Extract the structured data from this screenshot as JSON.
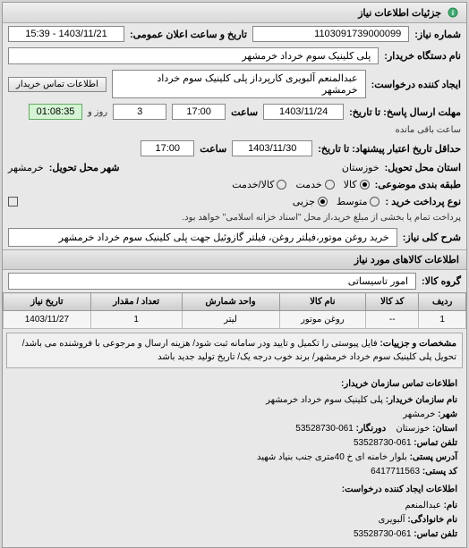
{
  "panel_title": "جزئیات اطلاعات نیاز",
  "header": {
    "req_number_label": "شماره نیاز:",
    "req_number": "1103091739000099",
    "announce_label": "تاریخ و ساعت اعلان عمومی:",
    "announce_value": "1403/11/21 - 15:39"
  },
  "buyer": {
    "org_label": "نام دستگاه خریدار:",
    "org_value": "پلی کلینیک سوم خرداد خرمشهر",
    "requester_label": "ایجاد کننده درخواست:",
    "requester_value": "عبدالمنعم آلبویری کارپرداز پلی کلینیک سوم خرداد خرمشهر",
    "contact_btn": "اطلاعات تماس خریدار"
  },
  "deadlines": {
    "response_label": "مهلت ارسال پاسخ: تا تاریخ:",
    "response_date": "1403/11/24",
    "time_label": "ساعت",
    "response_time": "17:00",
    "days_remaining": "3",
    "days_label": "روز و",
    "timer": "01:08:35",
    "timer_label": "ساعت باقی مانده",
    "validity_label": "حداقل تاریخ اعتبار پیشنهاد: تا تاریخ:",
    "validity_date": "1403/11/30",
    "validity_time": "17:00"
  },
  "location": {
    "delivery_state_label": "استان محل تحویل:",
    "delivery_state": "خوزستان",
    "delivery_city_label": "شهر محل تحویل:",
    "delivery_city": "خرمشهر"
  },
  "classification": {
    "subject_type_label": "طبقه بندی موضوعی:",
    "opt_goods": "کالا",
    "opt_service": "خدمت",
    "opt_both": "کالا/خدمت",
    "selected_subject": "goods",
    "purchase_type_label": "نوع پرداخت خرید :",
    "opt_medium": "متوسط",
    "opt_partial": "جزیی",
    "selected_purchase": "partial",
    "payment_note": "پرداخت تمام یا بخشی از مبلغ خرید،از محل \"اسناد خزانه اسلامی\" خواهد بود.",
    "payment_checkbox": false
  },
  "description": {
    "label": "شرح کلی نیاز:",
    "text": "خرید روغن موتور،فیلتر روغن، فیلتر گازوئیل جهت پلی کلینیک سوم خرداد خرمشهر"
  },
  "goods_section": {
    "heading": "اطلاعات کالاهای مورد نیاز",
    "group_label": "گروه کالا:",
    "group_value": "امور تاسیساتی"
  },
  "table": {
    "headers": {
      "row": "ردیف",
      "code": "کد کالا",
      "name": "نام کالا",
      "unit": "واحد شمارش",
      "qty": "تعداد / مقدار",
      "date": "تاریخ نیاز"
    },
    "rows": [
      {
        "row": "1",
        "code": "--",
        "name": "...",
        "unit": "روغن موتور",
        "unit2": "لیتر",
        "qty": "1",
        "date": "1403/11/27"
      }
    ]
  },
  "details": {
    "label": "مشخصات و جزییات:",
    "text": "فایل پیوستی را تکمیل و تایید ودر سامانه ثبت شود/ هزینه ارسال و مرجوعی با فروشنده می باشد/ تحویل پلی کلینیک سوم خرداد خرمشهر/ برند خوب درجه یک/ تاریخ تولید جدید باشد"
  },
  "contact": {
    "heading": "اطلاعات تماس سازمان خریدار:",
    "org_label": "نام سازمان خریدار:",
    "org": "پلی کلینیک سوم خرداد خرمشهر",
    "city_label": "شهر:",
    "city": "خرمشهر",
    "state_label": "استان:",
    "state": "خوزستان",
    "fax_label": "دورنگار:",
    "fax": "061-53528730",
    "phone_label": "تلفن تماس:",
    "phone": "061-53528730",
    "address_label": "آدرس پستی:",
    "address": "بلوار خامنه ای خ 40متری جنب بنیاد شهید",
    "postal_label": "کد پستی:",
    "postal": "6417711563",
    "requester_heading": "اطلاعات ایجاد کننده درخواست:",
    "name_label": "نام:",
    "name": "عبدالمنعم",
    "family_label": "نام خانوادگی:",
    "family": "آلبویری",
    "req_phone_label": "تلفن تماس:",
    "req_phone": "061-53528730"
  }
}
